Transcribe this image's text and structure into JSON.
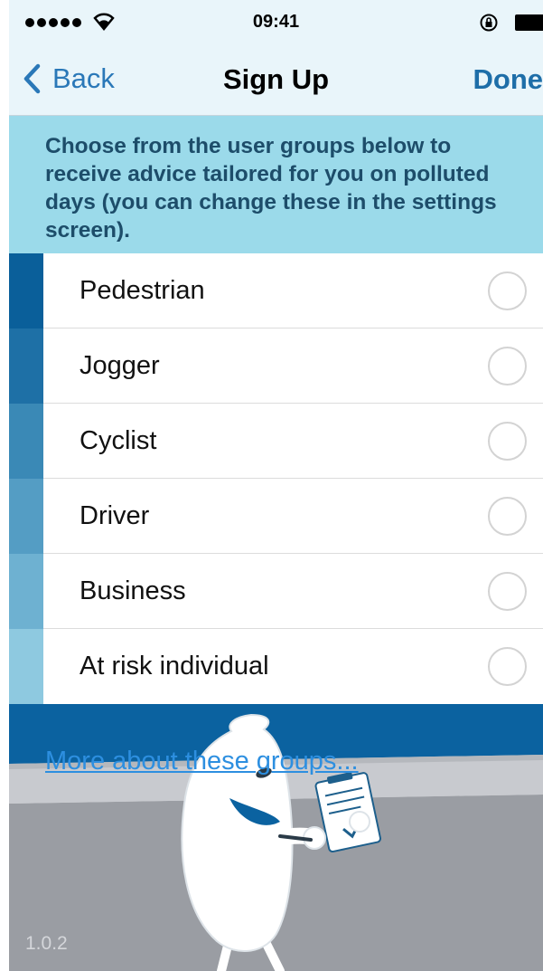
{
  "status_bar": {
    "time": "09:41",
    "signal_dots": 5,
    "icons": [
      "signal-dots-icon",
      "wifi-icon",
      "rotation-lock-icon",
      "battery-icon"
    ]
  },
  "nav": {
    "back_label": "Back",
    "title": "Sign Up",
    "done_label": "Done"
  },
  "info": {
    "text": "Choose from the user groups below to receive advice tailored for you on polluted days (you can change these in the settings screen)."
  },
  "groups": [
    {
      "label": "Pedestrian",
      "color": "#0a5f9a",
      "selected": false
    },
    {
      "label": "Jogger",
      "color": "#1e70a6",
      "selected": false
    },
    {
      "label": "Cyclist",
      "color": "#3a89b6",
      "selected": false
    },
    {
      "label": "Driver",
      "color": "#549dc4",
      "selected": false
    },
    {
      "label": "Business",
      "color": "#6eb1d1",
      "selected": false
    },
    {
      "label": "At risk individual",
      "color": "#8ec9e0",
      "selected": false
    }
  ],
  "footer": {
    "more_link": "More about these groups...",
    "version": "1.0.2"
  },
  "colors": {
    "nav_background": "#e9f5fa",
    "info_background": "#9bdaea",
    "info_text": "#1d4d6a",
    "accent_blue": "#2a78b8",
    "dark_band": "#0b62a0",
    "ground_grey": "#9a9da3",
    "link_blue": "#2d8fe0"
  }
}
